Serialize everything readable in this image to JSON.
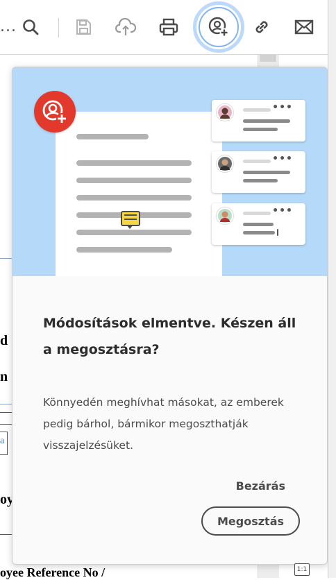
{
  "toolbar": {
    "overflow_label": "...",
    "icons": [
      "search-icon",
      "save-icon",
      "upload-icon",
      "print-icon",
      "share-user-icon",
      "link-icon",
      "mail-icon"
    ]
  },
  "document": {
    "fragment_d": "d",
    "fragment_n": "n",
    "fragment_oy": "oy",
    "fragment_a": "a",
    "footer_text": "oyee Reference No /"
  },
  "popover": {
    "title": "Módosítások elmentve. Készen áll a megosztásra?",
    "description": "Könnyedén meghívhat másokat, az emberek pedig bárhol, bármikor megoszthatják visszajelzésüket.",
    "close_label": "Bezárás",
    "share_label": "Megosztás"
  },
  "colors": {
    "accent_red": "#e3382c",
    "hero_blue": "#b5daf9",
    "focus_ring": "#7fb4f3",
    "comment_yellow": "#f4d742"
  }
}
